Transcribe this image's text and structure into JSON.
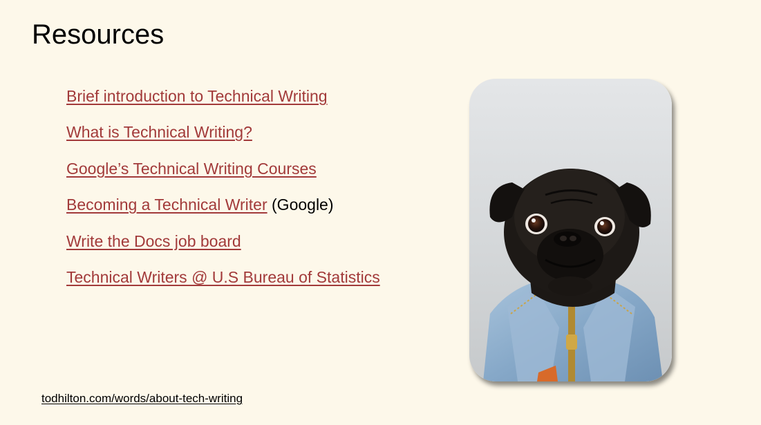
{
  "slide": {
    "title": "Resources",
    "footer_link": "todhilton.com/words/about-tech-writing"
  },
  "resources": [
    {
      "label": "Brief introduction to Technical Writing",
      "note": ""
    },
    {
      "label": "What is Technical Writing?",
      "note": ""
    },
    {
      "label": "Google’s Technical Writing Courses",
      "note": ""
    },
    {
      "label": "Becoming a Technical Writer",
      "note": " (Google)"
    },
    {
      "label": "Write the Docs job board",
      "note": ""
    },
    {
      "label": "Technical Writers @ U.S Bureau of Statistics",
      "note": ""
    }
  ],
  "colors": {
    "background": "#fdf8ea",
    "link": "#a23a3a",
    "text": "#000000"
  },
  "image": {
    "subject": "pug-in-denim-jacket-photo"
  }
}
